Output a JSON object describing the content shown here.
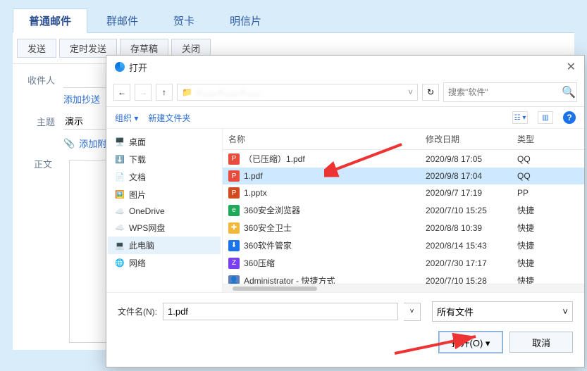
{
  "tabs": [
    "普通邮件",
    "群邮件",
    "贺卡",
    "明信片"
  ],
  "toolbar": {
    "send": "发送",
    "scheduled": "定时发送",
    "draft": "存草稿",
    "close": "关闭"
  },
  "form": {
    "recipient_label": "收件人",
    "add_cc": "添加抄送",
    "subject_label": "主题",
    "subject_value": "演示",
    "attach": "添加附件",
    "body_label": "正文"
  },
  "dialog": {
    "title": "打开",
    "search_placeholder": "搜索\"软件\"",
    "organize": "组织",
    "new_folder": "新建文件夹",
    "tree": [
      {
        "icon": "desktop",
        "label": "桌面",
        "color": "#f1b93b"
      },
      {
        "icon": "download",
        "label": "下载",
        "color": "#f1b93b"
      },
      {
        "icon": "doc",
        "label": "文档",
        "color": "#f1b93b"
      },
      {
        "icon": "pic",
        "label": "图片",
        "color": "#f1b93b"
      },
      {
        "icon": "cloud",
        "label": "OneDrive",
        "color": "#0a5bcf"
      },
      {
        "icon": "cloud",
        "label": "WPS网盘",
        "color": "#0a5bcf"
      },
      {
        "icon": "pc",
        "label": "此电脑",
        "color": "#3b7ec2",
        "selected": true
      },
      {
        "icon": "net",
        "label": "网络",
        "color": "#3b7ec2"
      }
    ],
    "columns": {
      "name": "名称",
      "date": "修改日期",
      "type": "类型"
    },
    "files": [
      {
        "icon": "pdf",
        "name": "（已压缩）1.pdf",
        "date": "2020/9/8 17:05",
        "type": "QQ"
      },
      {
        "icon": "pdf",
        "name": "1.pdf",
        "date": "2020/9/8 17:04",
        "type": "QQ",
        "selected": true
      },
      {
        "icon": "pptx",
        "name": "1.pptx",
        "date": "2020/9/7 17:19",
        "type": "PP"
      },
      {
        "icon": "360b",
        "name": "360安全浏览器",
        "date": "2020/7/10 15:25",
        "type": "快捷"
      },
      {
        "icon": "360s",
        "name": "360安全卫士",
        "date": "2020/8/8 10:39",
        "type": "快捷"
      },
      {
        "icon": "360m",
        "name": "360软件管家",
        "date": "2020/8/14 15:43",
        "type": "快捷"
      },
      {
        "icon": "360z",
        "name": "360压缩",
        "date": "2020/7/30 17:17",
        "type": "快捷"
      },
      {
        "icon": "user",
        "name": "Administrator - 快捷方式",
        "date": "2020/7/10 15:28",
        "type": "快捷"
      }
    ],
    "filename_label": "文件名(N):",
    "filename_value": "1.pdf",
    "filter": "所有文件",
    "open_btn": "打开(O)",
    "cancel_btn": "取消"
  }
}
